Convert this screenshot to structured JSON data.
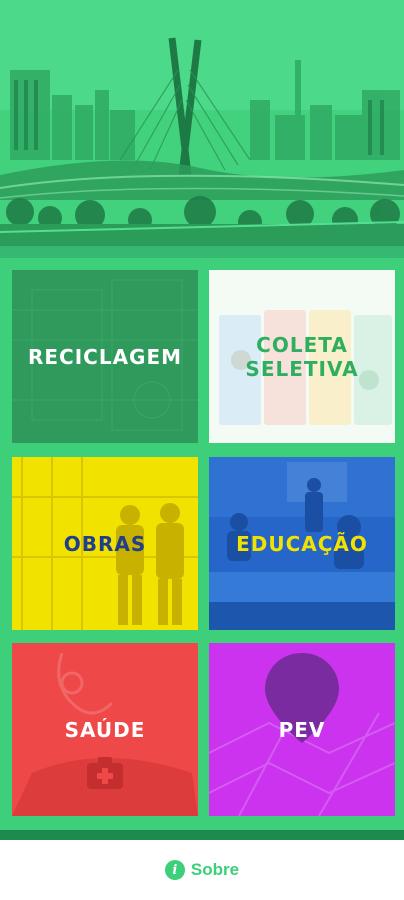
{
  "colors": {
    "brand_green": "#3ecf7a",
    "dark_green": "#1f8a4d",
    "reciclagem": "#2f9a5c",
    "coleta_seletiva": "#f4faf4",
    "obras": "#f2e200",
    "educacao": "#2566c8",
    "saude": "#ef4848",
    "pev": "#cc33ee"
  },
  "tiles": [
    {
      "label": "RECICLAGEM",
      "icon": "recycling-bin-photo"
    },
    {
      "label": "COLETA\nSELETIVA",
      "icon": "recycle-icon"
    },
    {
      "label": "OBRAS",
      "icon": "construction-workers-photo"
    },
    {
      "label": "EDUCAÇÃO",
      "icon": "classroom-photo"
    },
    {
      "label": "SAÚDE",
      "icon": "medical-kit-icon"
    },
    {
      "label": "PEV",
      "icon": "map-pin-icon"
    }
  ],
  "footer": {
    "about_label": "Sobre",
    "about_icon": "info-icon"
  }
}
